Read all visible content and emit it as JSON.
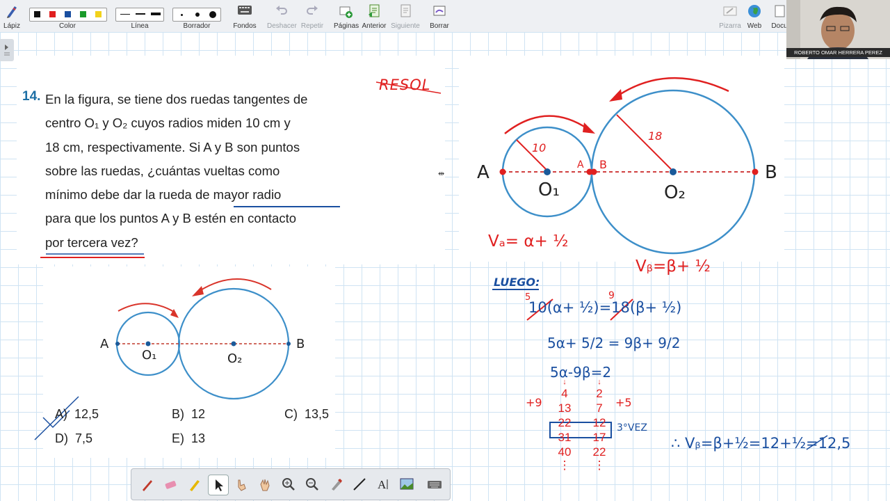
{
  "toolbar": {
    "items": [
      {
        "label": "Lápiz",
        "icon": "pencil-icon"
      },
      {
        "label": "Color",
        "icon": "color-palette-icon"
      },
      {
        "label": "Línea",
        "icon": "line-width-icon"
      },
      {
        "label": "Borrador",
        "icon": "eraser-size-icon"
      },
      {
        "label": "Fondos",
        "icon": "keyboard-icon"
      },
      {
        "label": "Deshacer",
        "icon": "undo-icon"
      },
      {
        "label": "Repetir",
        "icon": "redo-icon"
      },
      {
        "label": "Páginas",
        "icon": "pages-icon"
      },
      {
        "label": "Anterior",
        "icon": "previous-page-icon"
      },
      {
        "label": "Siguiente",
        "icon": "next-page-icon"
      },
      {
        "label": "Borrar",
        "icon": "clear-icon"
      },
      {
        "label": "Pizarra",
        "icon": "whiteboard-icon"
      },
      {
        "label": "Web",
        "icon": "globe-icon"
      },
      {
        "label": "Docu",
        "icon": "document-icon"
      }
    ],
    "colors": [
      "#111111",
      "#e02020",
      "#1a4fa0",
      "#1a9a2a",
      "#f2d21b"
    ]
  },
  "webcam": {
    "name": "ROBERTO OMAR HERRERA PEREZ"
  },
  "problem": {
    "number": "14.",
    "lines": [
      "En la figura, se tiene dos ruedas tangentes de",
      "centro O₁ y O₂ cuyos radios miden 10 cm y",
      "18 cm, respectivamente. Si A y B son puntos",
      "sobre las ruedas, ¿cuántas vueltas como",
      "mínimo debe dar la rueda de mayor radio",
      "para que los puntos A y B estén en contacto",
      "por tercera vez?"
    ]
  },
  "figure": {
    "A": "A",
    "B": "B",
    "O1": "O₁",
    "O2": "O₂"
  },
  "options": [
    {
      "key": "A)",
      "value": "12,5"
    },
    {
      "key": "B)",
      "value": "12"
    },
    {
      "key": "C)",
      "value": "13,5"
    },
    {
      "key": "D)",
      "value": "7,5"
    },
    {
      "key": "E)",
      "value": "13"
    }
  ],
  "right_figure": {
    "A": "A",
    "B": "B",
    "O1": "O₁",
    "O2": "O₂",
    "a_small": "A",
    "b_small": "B",
    "r1": "10",
    "r2": "18"
  },
  "annotations": {
    "resol": "RESOL",
    "va": "Vₐ= α+ ½",
    "vb": "Vᵦ=β+ ½",
    "luego": "LUEGO:",
    "eq1": "10(α+ ½)=18(β+ ½)",
    "eq1_red5": "5",
    "eq1_red9": "9",
    "eq2": "5α+ 5/2 = 9β+ 9/2",
    "eq3": "5α-9β=2",
    "plus9": "+9",
    "plus5": "+5",
    "col_alpha": [
      "4",
      "13",
      "22",
      "31",
      "40",
      "⋮"
    ],
    "col_beta": [
      "2",
      "7",
      "12",
      "17",
      "22",
      "⋮"
    ],
    "tercera": "3°VEZ",
    "final": "∴ Vᵦ=β+½=12+½=12,5"
  },
  "bottom_tools": [
    "pen-icon",
    "highlighter-eraser-icon",
    "marker-icon",
    "pointer-icon",
    "hand-pointer-icon",
    "hand-pan-icon",
    "zoom-in-icon",
    "zoom-out-icon",
    "eyedropper-icon",
    "line-tool-icon",
    "text-tool-icon",
    "image-tool-icon",
    "keyboard-icon"
  ]
}
